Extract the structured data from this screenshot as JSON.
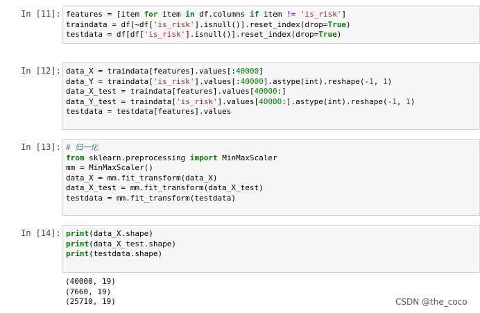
{
  "cells": [
    {
      "prompt": "In [11]:",
      "lines": [
        [
          [
            "features = [item ",
            ""
          ],
          [
            "for",
            "kw"
          ],
          [
            " item ",
            ""
          ],
          [
            "in",
            "kw"
          ],
          [
            " df.columns ",
            ""
          ],
          [
            "if",
            "kw"
          ],
          [
            " item ",
            ""
          ],
          [
            "!=",
            "op"
          ],
          [
            " ",
            ""
          ],
          [
            "'is_risk'",
            "str"
          ],
          [
            "]",
            ""
          ]
        ],
        [
          [
            "traindata = df[~df[",
            ""
          ],
          [
            "'is_risk'",
            "str"
          ],
          [
            "].isnull()].reset_index(drop=",
            ""
          ],
          [
            "True",
            "kw"
          ],
          [
            ")",
            ""
          ]
        ],
        [
          [
            "testdata = df[df[",
            ""
          ],
          [
            "'is_risk'",
            "str"
          ],
          [
            "].isnull()].reset_index(drop=",
            ""
          ],
          [
            "True",
            "kw"
          ],
          [
            ")",
            ""
          ]
        ]
      ]
    },
    {
      "prompt": "In [12]:",
      "lines": [
        [
          [
            "data_X = traindata[features].values[:",
            ""
          ],
          [
            "40000",
            "num"
          ],
          [
            "]",
            ""
          ]
        ],
        [
          [
            "data_Y = traindata[",
            ""
          ],
          [
            "'is_risk'",
            "str"
          ],
          [
            "].values[:",
            ""
          ],
          [
            "40000",
            "num"
          ],
          [
            "].astype(int).reshape(-",
            ""
          ],
          [
            "1",
            "num"
          ],
          [
            ", ",
            ""
          ],
          [
            "1",
            "num"
          ],
          [
            ")",
            ""
          ]
        ],
        [
          [
            "data_X_test = traindata[features].values[",
            ""
          ],
          [
            "40000",
            "num"
          ],
          [
            ":]",
            ""
          ]
        ],
        [
          [
            "data_Y_test = traindata[",
            ""
          ],
          [
            "'is_risk'",
            "str"
          ],
          [
            "].values[",
            ""
          ],
          [
            "40000",
            "num"
          ],
          [
            ":].astype(int).reshape(-",
            ""
          ],
          [
            "1",
            "num"
          ],
          [
            ", ",
            ""
          ],
          [
            "1",
            "num"
          ],
          [
            ")",
            ""
          ]
        ],
        [
          [
            "testdata = testdata[features].values",
            ""
          ]
        ]
      ]
    },
    {
      "prompt": "In [13]:",
      "lines": [
        [
          [
            "# 归一化",
            "cm"
          ]
        ],
        [
          [
            "from",
            "kw"
          ],
          [
            " sklearn.preprocessing ",
            ""
          ],
          [
            "import",
            "kw"
          ],
          [
            " MinMaxScaler",
            ""
          ]
        ],
        [
          [
            "mm = MinMaxScaler()",
            ""
          ]
        ],
        [
          [
            "data_X = mm.fit_transform(data_X)",
            ""
          ]
        ],
        [
          [
            "data_X_test = mm.fit_transform(data_X_test)",
            ""
          ]
        ],
        [
          [
            "testdata = mm.fit_transform(testdata)",
            ""
          ]
        ]
      ]
    },
    {
      "prompt": "In [14]:",
      "lines": [
        [
          [
            "print",
            "kw"
          ],
          [
            "(data_X.shape)",
            ""
          ]
        ],
        [
          [
            "print",
            "kw"
          ],
          [
            "(data_X_test.shape)",
            ""
          ]
        ],
        [
          [
            "print",
            "kw"
          ],
          [
            "(testdata.shape)",
            ""
          ]
        ]
      ]
    }
  ],
  "output_lines": [
    "(40000, 19)",
    "(7660, 19)",
    "(25710, 19)"
  ],
  "watermark": "CSDN @the_coco"
}
